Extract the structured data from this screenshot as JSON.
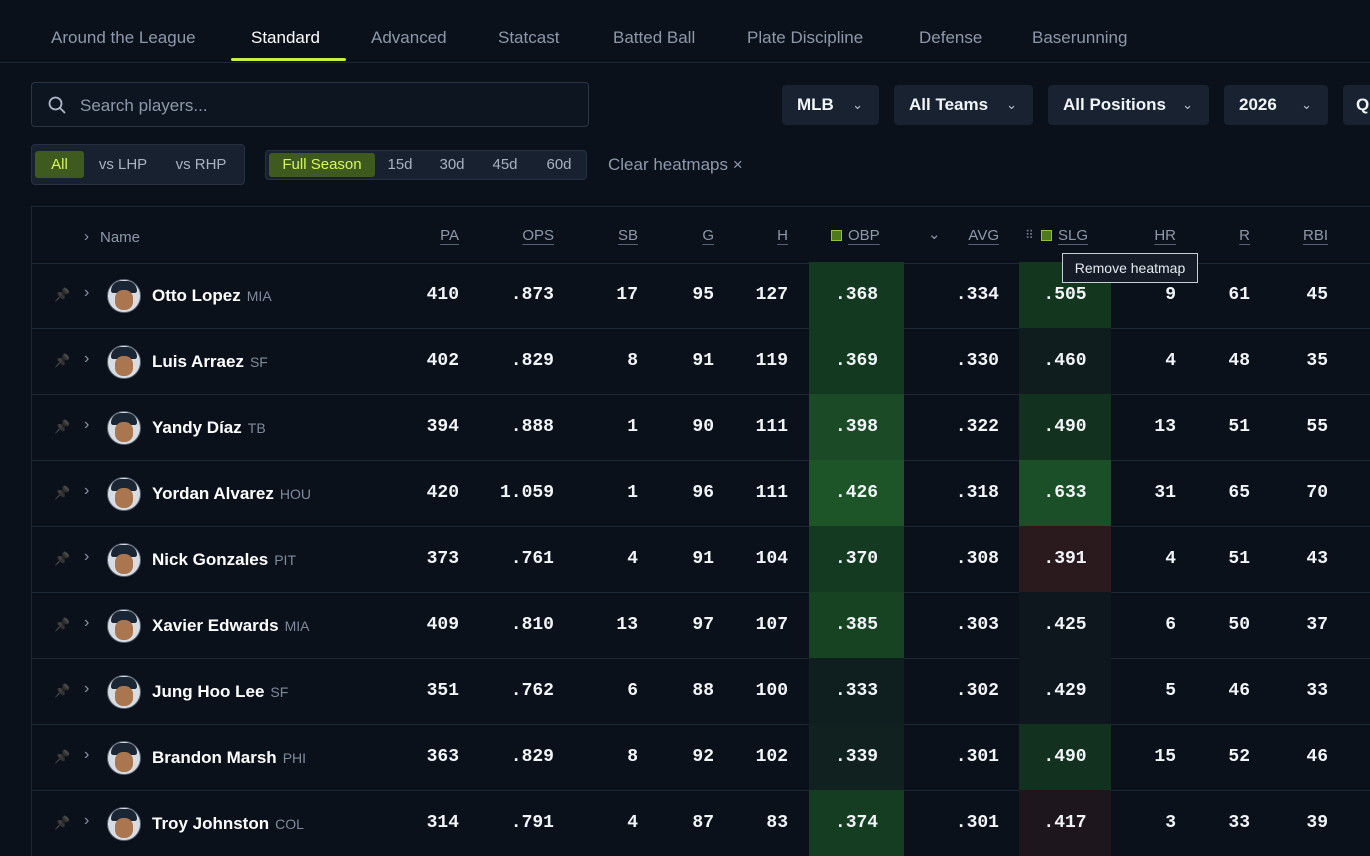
{
  "nav": {
    "tabs": [
      {
        "label": "Around the League"
      },
      {
        "label": "Standard",
        "active": true
      },
      {
        "label": "Advanced"
      },
      {
        "label": "Statcast"
      },
      {
        "label": "Batted Ball"
      },
      {
        "label": "Plate Discipline"
      },
      {
        "label": "Defense"
      },
      {
        "label": "Baserunning"
      }
    ]
  },
  "search": {
    "placeholder": "Search players..."
  },
  "filters": {
    "league": "MLB",
    "teams": "All Teams",
    "positions": "All Positions",
    "season": "2026",
    "more": "Q"
  },
  "split": {
    "options": [
      "All",
      "vs LHP",
      "vs RHP"
    ],
    "selected": "All"
  },
  "range": {
    "options": [
      "Full Season",
      "15d",
      "30d",
      "45d",
      "60d"
    ],
    "selected": "Full Season"
  },
  "clear_heatmaps": "Clear heatmaps ×",
  "table": {
    "columns": [
      "Name",
      "PA",
      "OPS",
      "SB",
      "G",
      "H",
      "OBP",
      "AVG",
      "SLG",
      "HR",
      "R",
      "RBI"
    ],
    "sort_indicator": "⌄",
    "heatmap_columns": [
      "OBP",
      "SLG"
    ],
    "rows": [
      {
        "name": "Otto Lopez",
        "team": "MIA",
        "pa": "410",
        "ops": ".873",
        "sb": "17",
        "g": "95",
        "h": "127",
        "obp": ".368",
        "avg": ".334",
        "slg": ".505",
        "hr": "9",
        "r": "61",
        "rbi": "45",
        "obp_heat": "#133a21",
        "slg_heat": "#12361e"
      },
      {
        "name": "Luis Arraez",
        "team": "SF",
        "pa": "402",
        "ops": ".829",
        "sb": "8",
        "g": "91",
        "h": "119",
        "obp": ".369",
        "avg": ".330",
        "slg": ".460",
        "hr": "4",
        "r": "48",
        "rbi": "35",
        "obp_heat": "#133a21",
        "slg_heat": "#0f1d1f"
      },
      {
        "name": "Yandy Díaz",
        "team": "TB",
        "pa": "394",
        "ops": ".888",
        "sb": "1",
        "g": "90",
        "h": "111",
        "obp": ".398",
        "avg": ".322",
        "slg": ".490",
        "hr": "13",
        "r": "51",
        "rbi": "55",
        "obp_heat": "#1a4a26",
        "slg_heat": "#12311f"
      },
      {
        "name": "Yordan Alvarez",
        "team": "HOU",
        "pa": "420",
        "ops": "1.059",
        "sb": "1",
        "g": "96",
        "h": "111",
        "obp": ".426",
        "avg": ".318",
        "slg": ".633",
        "hr": "31",
        "r": "65",
        "rbi": "70",
        "obp_heat": "#1d5428",
        "slg_heat": "#1b4f27"
      },
      {
        "name": "Nick Gonzales",
        "team": "PIT",
        "pa": "373",
        "ops": ".761",
        "sb": "4",
        "g": "91",
        "h": "104",
        "obp": ".370",
        "avg": ".308",
        "slg": ".391",
        "hr": "4",
        "r": "51",
        "rbi": "43",
        "obp_heat": "#143b22",
        "slg_heat": "#2a1a1e"
      },
      {
        "name": "Xavier Edwards",
        "team": "MIA",
        "pa": "409",
        "ops": ".810",
        "sb": "13",
        "g": "97",
        "h": "107",
        "obp": ".385",
        "avg": ".303",
        "slg": ".425",
        "hr": "6",
        "r": "50",
        "rbi": "37",
        "obp_heat": "#174323",
        "slg_heat": "#0e171d"
      },
      {
        "name": "Jung Hoo Lee",
        "team": "SF",
        "pa": "351",
        "ops": ".762",
        "sb": "6",
        "g": "88",
        "h": "100",
        "obp": ".333",
        "avg": ".302",
        "slg": ".429",
        "hr": "5",
        "r": "46",
        "rbi": "33",
        "obp_heat": "#0f1e1e",
        "slg_heat": "#0e171d"
      },
      {
        "name": "Brandon Marsh",
        "team": "PHI",
        "pa": "363",
        "ops": ".829",
        "sb": "8",
        "g": "92",
        "h": "102",
        "obp": ".339",
        "avg": ".301",
        "slg": ".490",
        "hr": "15",
        "r": "52",
        "rbi": "46",
        "obp_heat": "#10211f",
        "slg_heat": "#12311f"
      },
      {
        "name": "Troy Johnston",
        "team": "COL",
        "pa": "314",
        "ops": ".791",
        "sb": "4",
        "g": "87",
        "h": "83",
        "obp": ".374",
        "avg": ".301",
        "slg": ".417",
        "hr": "3",
        "r": "33",
        "rbi": "39",
        "obp_heat": "#143d22",
        "slg_heat": "#1d171d"
      }
    ]
  },
  "tooltip": "Remove heatmap",
  "colors": {
    "accent": "#c7f041",
    "background": "#0b111b",
    "heat_strong": "#1d5428",
    "heat_cold": "#2a1a1e"
  }
}
